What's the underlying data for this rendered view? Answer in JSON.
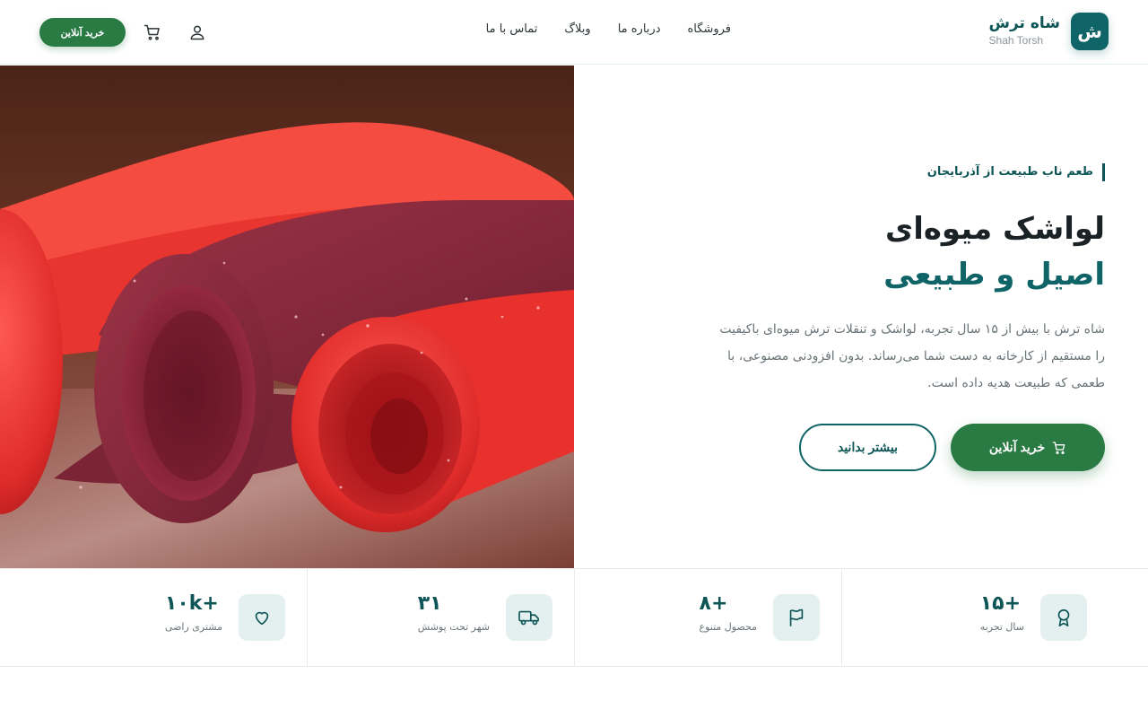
{
  "brand": {
    "logo_letter": "ش",
    "name_fa": "شاه ترش",
    "name_en": "Shah Torsh"
  },
  "nav": {
    "items": [
      "فروشگاه",
      "درباره ما",
      "وبلاگ",
      "تماس با ما"
    ]
  },
  "header": {
    "buy_label": "خرید آنلاین",
    "icons": [
      "user-icon",
      "cart-icon"
    ]
  },
  "hero": {
    "tagline": "طعم ناب طبیعت از آذربایجان",
    "title_line1": "لواشک میوه‌ای",
    "title_line2": "اصیل و طبیعی",
    "description": "شاه ترش با بیش از ۱۵ سال تجربه، لواشک و تنقلات ترش میوه‌ای باکیفیت را مستقیم از کارخانه به دست شما می‌رساند. بدون افزودنی مصنوعی، با طعمی که طبیعت هدیه داده است.",
    "primary_button": "خرید آنلاین",
    "secondary_button": "بیشتر بدانید"
  },
  "stats": [
    {
      "value": "+۱۵",
      "label": "سال تجربه",
      "icon": "award-icon"
    },
    {
      "value": "+۸",
      "label": "محصول متنوع",
      "icon": "flag-icon"
    },
    {
      "value": "۳۱",
      "label": "شهر تحت پوشش",
      "icon": "truck-icon"
    },
    {
      "value": "+۱۰k",
      "label": "مشتری راضی",
      "icon": "heart-icon"
    }
  ],
  "colors": {
    "brand_teal": "#0e6466",
    "brand_green": "#2a7a44",
    "icon_bg": "#e3f0ef"
  }
}
